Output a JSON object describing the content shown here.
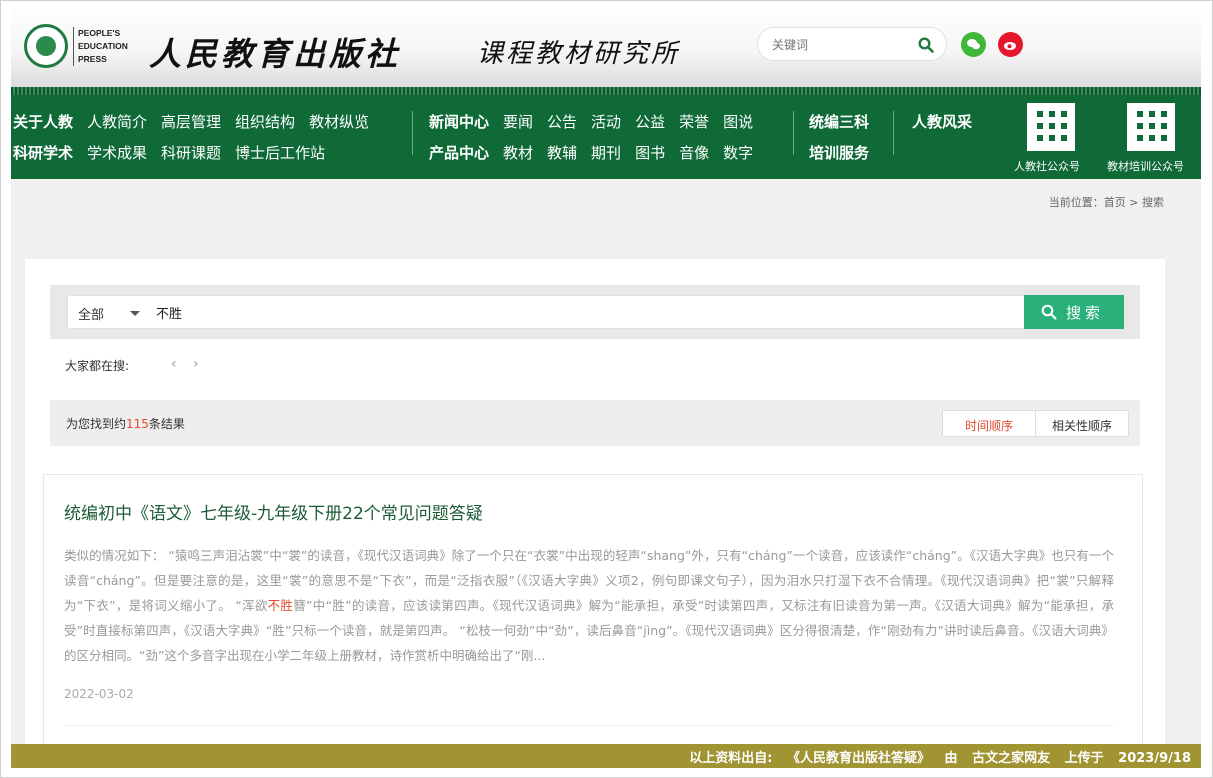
{
  "header": {
    "logo_en_lines": [
      "PEOPLE'S",
      "EDUCATION",
      "PRESS"
    ],
    "brand_cn": "人民教育出版社",
    "brand_sub": "课程教材研究所",
    "search_placeholder": "关键词"
  },
  "nav": {
    "row1_left": [
      "关于人教",
      "人教简介",
      "高层管理",
      "组织结构",
      "教材纵览"
    ],
    "row2_left": [
      "科研学术",
      "学术成果",
      "科研课题",
      "博士后工作站"
    ],
    "row1_mid": [
      "新闻中心",
      "要闻",
      "公告",
      "活动",
      "公益",
      "荣誉",
      "图说"
    ],
    "row2_mid": [
      "产品中心",
      "教材",
      "教辅",
      "期刊",
      "图书",
      "音像",
      "数字"
    ],
    "row1_right": [
      "统编三科"
    ],
    "row2_right": [
      "培训服务"
    ],
    "row1_far": [
      "人教风采"
    ],
    "qr_labels": [
      "人教社公众号",
      "教材培训公众号"
    ]
  },
  "breadcrumb": "当前位置：首页 > 搜索",
  "search": {
    "scope": "全部",
    "query": "不胜",
    "button": "搜索",
    "hot_label": "大家都在搜:",
    "prev": "‹",
    "next": "›"
  },
  "results": {
    "prefix": "为您找到约",
    "count": "115",
    "suffix": "条结果",
    "sort_time": "时间顺序",
    "sort_relevance": "相关性顺序"
  },
  "result_item": {
    "title": "统编初中《语文》七年级-九年级下册22个常见问题答疑",
    "body_before": "类似的情况如下：        “猿鸣三声泪沾裳”中“裳”的读音，《现代汉语词典》除了一个只在“衣裳”中出现的轻声“shang”外，只有“cháng”一个读音，应该读作“cháng”。《汉语大字典》也只有一个读音“cháng”。但是要注意的是，这里“裳”的意思不是“下衣”，而是“泛指衣服”（《汉语大字典》义项2，例句即课文句子），因为泪水只打湿下衣不合情理。《现代汉语词典》把“裳”只解释为“下衣”，是将词义缩小了。        “浑欲",
    "body_highlight": "不胜",
    "body_after": "簪”中“胜”的读音，应该读第四声。《现代汉语词典》解为“能承担，承受”时读第四声，又标注有旧读音为第一声。《汉语大词典》解为“能承担，承受”时直接标第四声，《汉语大字典》“胜”只标一个读音，就是第四声。        “松枝一何劲”中“劲”，读后鼻音“jìng”。《现代汉语词典》区分得很清楚，作“刚劲有力”讲时读后鼻音。《汉语大词典》的区分相同。“劲”这个多音字出现在小学二年级上册教材，诗作赏析中明确给出了“刚...",
    "date": "2022-03-02"
  },
  "footer": {
    "label": "以上资料出自:",
    "source": "《人民教育出版社答疑》",
    "by": "由",
    "user": "古文之家网友",
    "uploaded": "上传于",
    "date": "2023/9/18"
  }
}
